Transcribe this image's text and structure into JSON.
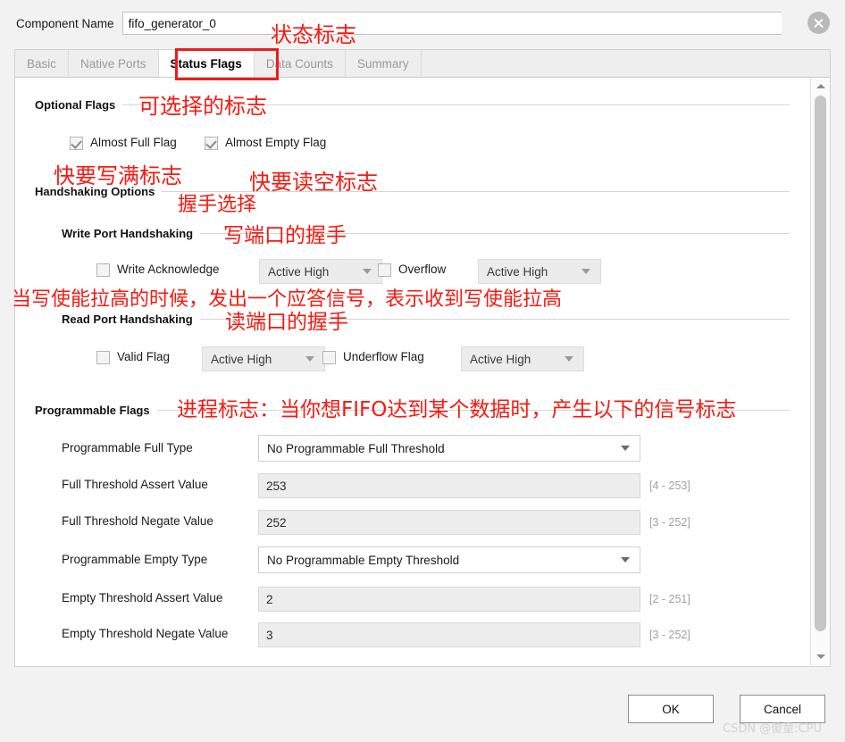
{
  "header": {
    "component_name_label": "Component Name",
    "component_name_value": "fifo_generator_0",
    "close_icon": "close-circle-icon"
  },
  "tabs": [
    {
      "label": "Basic",
      "active": false
    },
    {
      "label": "Native Ports",
      "active": false
    },
    {
      "label": "Status Flags",
      "active": true
    },
    {
      "label": "Data Counts",
      "active": false
    },
    {
      "label": "Summary",
      "active": false
    }
  ],
  "sections": {
    "optional_flags": "Optional Flags",
    "handshaking_options": "Handshaking Options",
    "write_port_handshaking": "Write Port Handshaking",
    "read_port_handshaking": "Read Port Handshaking",
    "programmable_flags": "Programmable Flags"
  },
  "optional_flags": {
    "almost_full": {
      "label": "Almost Full Flag",
      "checked": true
    },
    "almost_empty": {
      "label": "Almost Empty Flag",
      "checked": true
    }
  },
  "write_port": {
    "write_acknowledge": {
      "label": "Write Acknowledge",
      "checked": false,
      "polarity": "Active High"
    },
    "overflow": {
      "label": "Overflow",
      "checked": false,
      "polarity": "Active High"
    }
  },
  "read_port": {
    "valid_flag": {
      "label": "Valid Flag",
      "checked": false,
      "polarity": "Active High"
    },
    "underflow_flag": {
      "label": "Underflow Flag",
      "checked": false,
      "polarity": "Active High"
    }
  },
  "programmable_flags": {
    "full_type": {
      "label": "Programmable Full Type",
      "value": "No Programmable Full Threshold"
    },
    "full_assert": {
      "label": "Full Threshold Assert Value",
      "value": "253",
      "range": "[4 - 253]"
    },
    "full_negate": {
      "label": "Full Threshold Negate Value",
      "value": "252",
      "range": "[3 - 252]"
    },
    "empty_type": {
      "label": "Programmable Empty Type",
      "value": "No Programmable Empty Threshold"
    },
    "empty_assert": {
      "label": "Empty Threshold Assert Value",
      "value": "2",
      "range": "[2 - 251]"
    },
    "empty_negate": {
      "label": "Empty Threshold Negate Value",
      "value": "3",
      "range": "[3 - 252]"
    }
  },
  "annotations": {
    "status_flags": "状态标志",
    "optional_flags": "可选择的标志",
    "almost_full": "快要写满标志",
    "almost_empty": "快要读空标志",
    "handshaking": "握手选择",
    "write_port": "写端口的握手",
    "write_ack_desc": "当写使能拉高的时候，发出一个应答信号，表示收到写使能拉高",
    "read_port": "读端口的握手",
    "programmable_flags": "进程标志：当你想FIFO达到某个数据时，产生以下的信号标志"
  },
  "footer": {
    "ok_label": "OK",
    "cancel_label": "Cancel",
    "watermark": "CSDN @傻童:CPU"
  },
  "scrollbar": {
    "up_icon": "chevron-up-icon",
    "down_icon": "chevron-down-icon"
  },
  "colors": {
    "annotation_red": "#f41b12",
    "panel_bg": "#ffffff",
    "window_bg": "#f2f2f2"
  }
}
